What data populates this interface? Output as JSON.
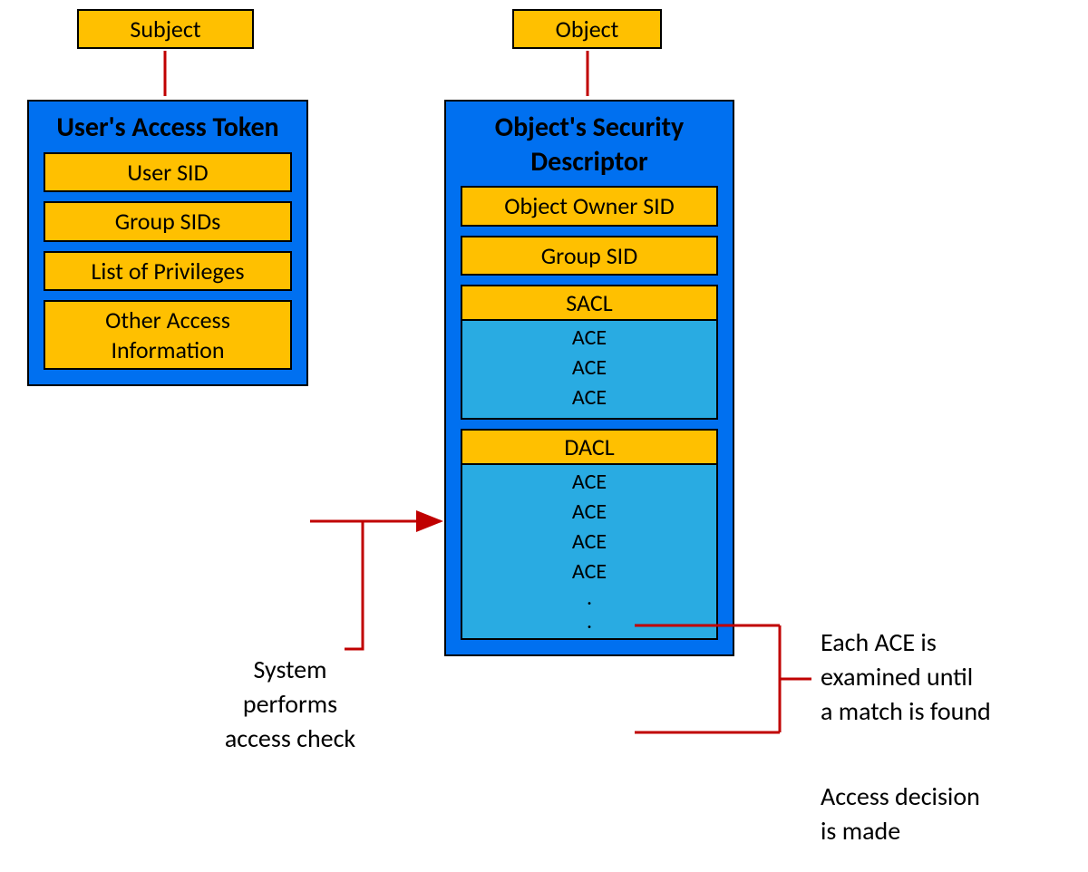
{
  "subject_label": "Subject",
  "object_label": "Object",
  "left_panel": {
    "title": "User's Access Token",
    "items": [
      "User SID",
      "Group SIDs",
      "List of Privileges",
      "Other Access Information"
    ]
  },
  "right_panel": {
    "title": "Object's Security Descriptor",
    "owner_sid": "Object Owner SID",
    "group_sid": "Group SID",
    "sacl": {
      "label": "SACL",
      "aces": [
        "ACE",
        "ACE",
        "ACE"
      ]
    },
    "dacl": {
      "label": "DACL",
      "aces": [
        "ACE",
        "ACE",
        "ACE",
        "ACE"
      ],
      "ellipsis": [
        ".",
        "."
      ]
    }
  },
  "captions": {
    "system_check": "System performs access check",
    "each_ace": "Each ACE is examined until a match is found",
    "decision": "Access decision is made"
  },
  "colors": {
    "orange": "#ffc000",
    "blue_panel": "#0070f0",
    "light_blue": "#29abe2",
    "red_line": "#c00000"
  }
}
